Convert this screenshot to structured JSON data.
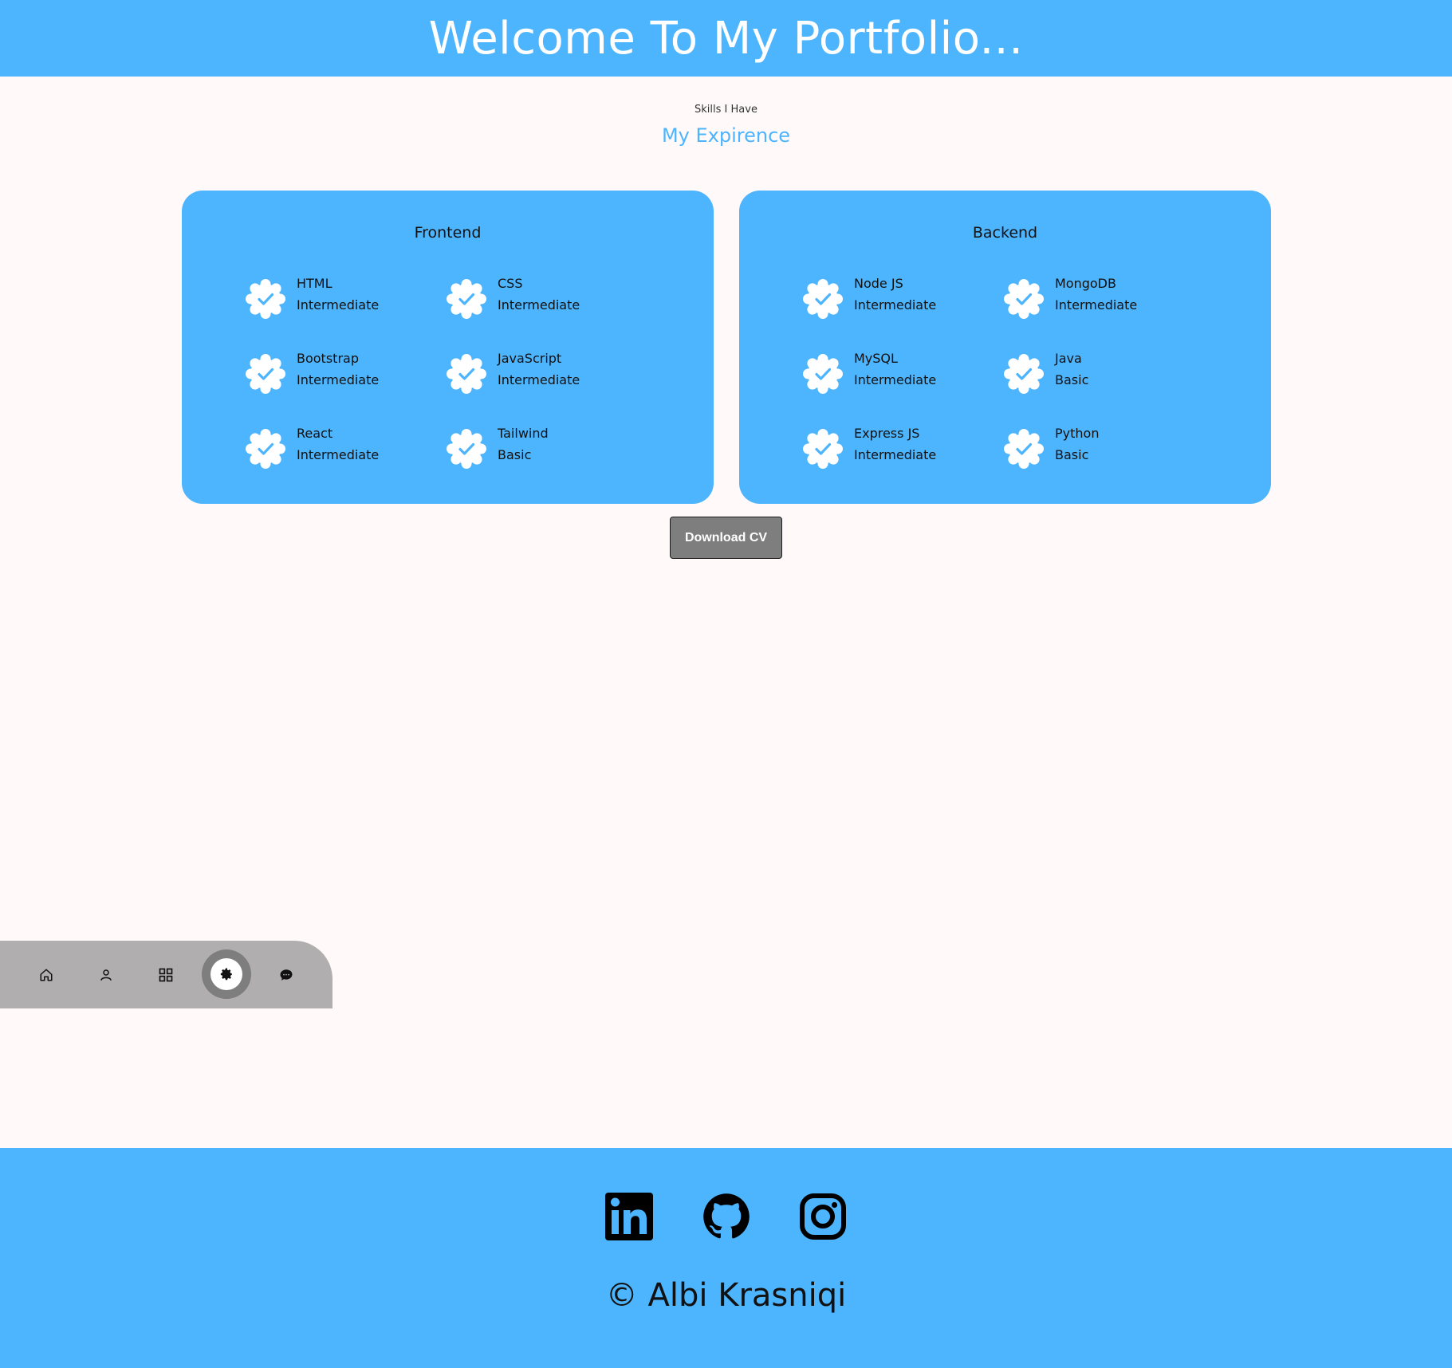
{
  "header": {
    "title": "Welcome To My Portfolio..."
  },
  "section": {
    "subtitle": "Skills I Have",
    "title": "My Expirence"
  },
  "cards": [
    {
      "title": "Frontend",
      "skills": [
        {
          "name": "HTML",
          "level": "Intermediate"
        },
        {
          "name": "CSS",
          "level": "Intermediate"
        },
        {
          "name": "Bootstrap",
          "level": "Intermediate"
        },
        {
          "name": "JavaScript",
          "level": "Intermediate"
        },
        {
          "name": "React",
          "level": "Intermediate"
        },
        {
          "name": "Tailwind",
          "level": "Basic"
        }
      ]
    },
    {
      "title": "Backend",
      "skills": [
        {
          "name": "Node JS",
          "level": "Intermediate"
        },
        {
          "name": "MongoDB",
          "level": "Intermediate"
        },
        {
          "name": "MySQL",
          "level": "Intermediate"
        },
        {
          "name": "Java",
          "level": "Basic"
        },
        {
          "name": "Express JS",
          "level": "Intermediate"
        },
        {
          "name": "Python",
          "level": "Basic"
        }
      ]
    }
  ],
  "download": {
    "label": "Download CV"
  },
  "nav": {
    "items": [
      {
        "icon": "home-icon"
      },
      {
        "icon": "user-icon"
      },
      {
        "icon": "grid-icon"
      },
      {
        "icon": "gear-icon",
        "active": true
      },
      {
        "icon": "chat-icon"
      }
    ]
  },
  "footer": {
    "socials": [
      {
        "icon": "linkedin-icon"
      },
      {
        "icon": "github-icon"
      },
      {
        "icon": "instagram-icon"
      }
    ],
    "copyright": "© Albi Krasniqi"
  },
  "colors": {
    "accent": "#4db4fe",
    "background": "#fffaf9",
    "button": "#7e7e7e",
    "nav": "#b0aeae"
  }
}
